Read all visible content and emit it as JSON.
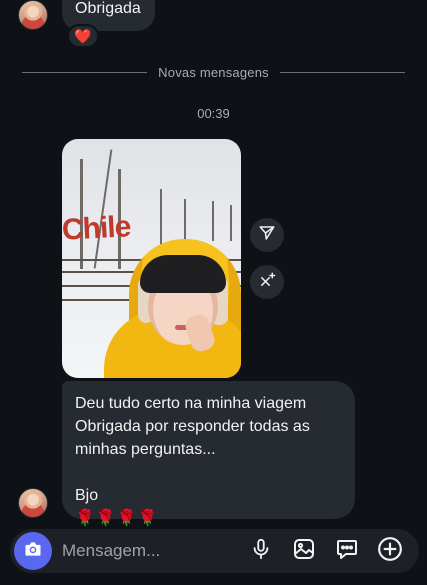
{
  "thread": {
    "top_message": "Obrigada",
    "top_reaction": "❤️",
    "divider_label": "Novas mensagens",
    "timestamp": "00:39",
    "last_message": "Deu tudo certo na minha viagem\nObrigada por responder todas as minhas perguntas...\n\nBjo",
    "last_message_emoji": "🌹🌹🌹🌹"
  },
  "composer": {
    "placeholder": "Mensagem..."
  },
  "icons": {
    "photo_actions": [
      "share-icon",
      "ai-edit-icon"
    ],
    "composer": [
      "camera-icon",
      "microphone-icon",
      "gallery-icon",
      "sticker-icon",
      "plus-icon"
    ]
  },
  "colors": {
    "background": "#0e1116",
    "bubble": "#262a31",
    "camera_button": "#5a67f0",
    "reaction_heart": "#ff2d55"
  }
}
